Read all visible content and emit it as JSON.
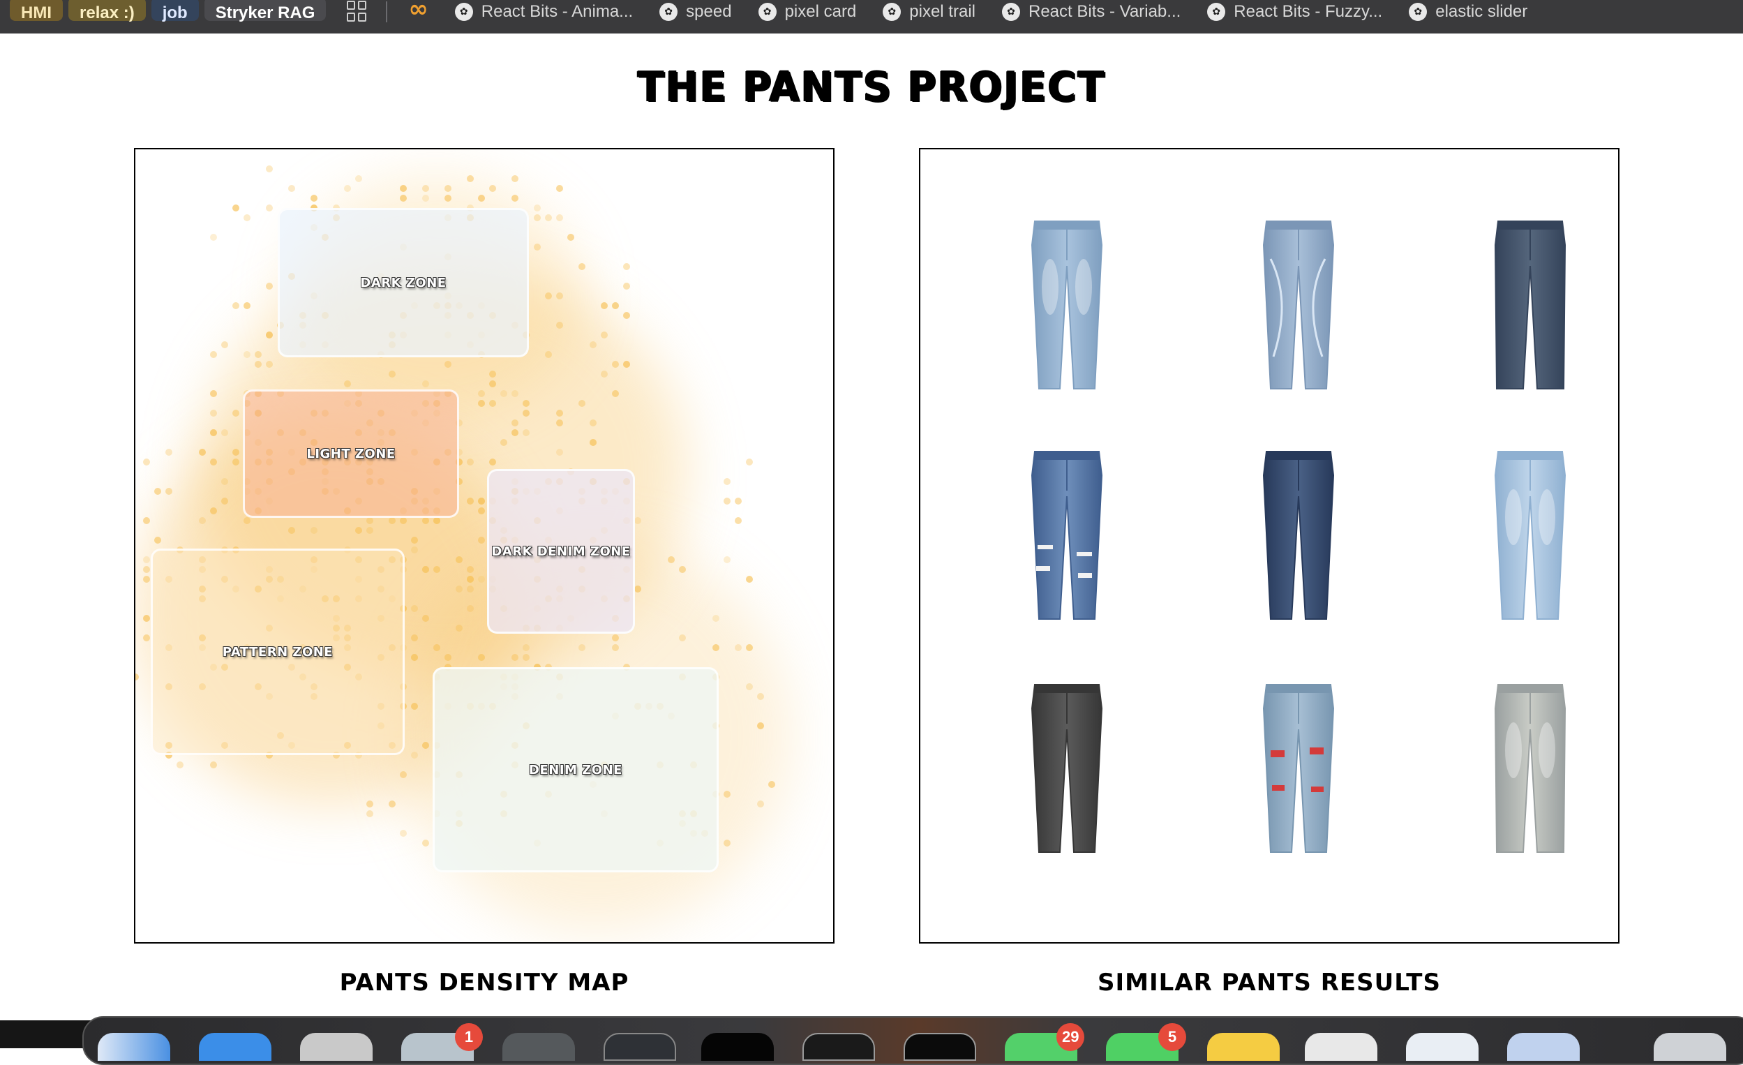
{
  "bookmarks": {
    "chips": [
      "HMI",
      "relax :)",
      "job",
      "Stryker RAG"
    ],
    "items": [
      "React Bits - Anima...",
      "speed",
      "pixel card",
      "pixel trail",
      "React Bits - Variab...",
      "React Bits - Fuzzy...",
      "elastic slider"
    ],
    "favicon_glyph": "✿"
  },
  "page": {
    "title": "THE PANTS PROJECT",
    "map_caption": "PANTS DENSITY MAP",
    "results_caption": "SIMILAR PANTS RESULTS"
  },
  "density_map": {
    "zones": [
      {
        "label": "DARK ZONE",
        "tint": "#eaf2fc"
      },
      {
        "label": "LIGHT ZONE",
        "tint": "#f7c9b6"
      },
      {
        "label": "DARK DENIM ZONE",
        "tint": "#ece6f6"
      },
      {
        "label": "PATTERN ZONE",
        "tint": "#fcebc8"
      },
      {
        "label": "DENIM ZONE",
        "tint": "#eef6f4"
      }
    ],
    "cloud_color": "#f7c460"
  },
  "results": {
    "items": [
      {
        "name": "light wash straight jeans",
        "wash": "#a9c3dd",
        "shade": "#7f9fc0",
        "style": "faded"
      },
      {
        "name": "light wash jeans with stitch curves",
        "wash": "#a8bfd8",
        "shade": "#7b96b6",
        "style": "stitched"
      },
      {
        "name": "grey-blue wide jeans",
        "wash": "#55667c",
        "shade": "#34435a",
        "style": "wide"
      },
      {
        "name": "distressed slim jeans",
        "wash": "#6f8fbb",
        "shade": "#3f5e8e",
        "style": "ripped"
      },
      {
        "name": "dark indigo straight jeans",
        "wash": "#4a6186",
        "shade": "#27395a",
        "style": "dark"
      },
      {
        "name": "bleached light jeans",
        "wash": "#bfd5ea",
        "shade": "#8fb0d1",
        "style": "faded"
      },
      {
        "name": "charcoal straight jeans",
        "wash": "#5b5b5b",
        "shade": "#363636",
        "style": "grey"
      },
      {
        "name": "light skinny jeans with red patches",
        "wash": "#a7bfd4",
        "shade": "#7896b0",
        "style": "patched"
      },
      {
        "name": "vintage stone wash jeans",
        "wash": "#c9ccc6",
        "shade": "#9aa0a0",
        "style": "vintage"
      }
    ]
  },
  "dock": {
    "badges": [
      "1",
      "29",
      "5"
    ]
  }
}
